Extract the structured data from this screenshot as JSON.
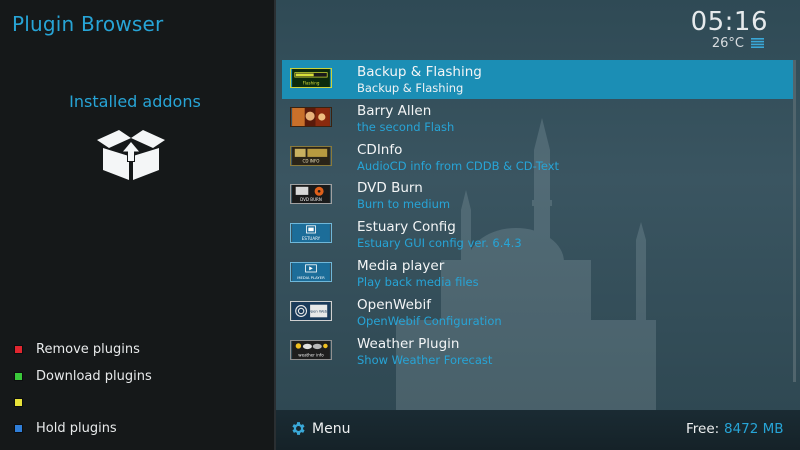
{
  "app": {
    "title": "Plugin Browser"
  },
  "left": {
    "section_title": "Installed addons",
    "box_icon": "open-box-icon",
    "color_keys": [
      {
        "color": "#e0262f",
        "label": "Remove plugins"
      },
      {
        "color": "#3ac83a",
        "label": "Download plugins"
      },
      {
        "color": "#e8e23a",
        "label": ""
      },
      {
        "color": "#2f7ed8",
        "label": "Hold plugins"
      }
    ]
  },
  "status": {
    "time": "05:16",
    "temperature": "26°C",
    "weather_icon": "weather-lines-icon"
  },
  "plugins": [
    {
      "name": "Backup & Flashing",
      "description": "Backup & Flashing",
      "thumb_icon": "flashing-icon",
      "selected": true
    },
    {
      "name": "Barry Allen",
      "description": "the second Flash",
      "thumb_icon": "barry-allen-icon",
      "selected": false
    },
    {
      "name": "CDInfo",
      "description": "AudioCD info from CDDB & CD-Text",
      "thumb_icon": "cdinfo-icon",
      "selected": false
    },
    {
      "name": "DVD Burn",
      "description": "Burn to medium",
      "thumb_icon": "dvd-burn-icon",
      "selected": false
    },
    {
      "name": "Estuary Config",
      "description": "Estuary GUI config ver. 6.4.3",
      "thumb_icon": "estuary-icon",
      "selected": false
    },
    {
      "name": "Media player",
      "description": "Play back media files",
      "thumb_icon": "media-player-icon",
      "selected": false
    },
    {
      "name": "OpenWebif",
      "description": "OpenWebif Configuration",
      "thumb_icon": "openwebif-icon",
      "selected": false
    },
    {
      "name": "Weather Plugin",
      "description": "Show Weather Forecast",
      "thumb_icon": "weather-info-icon",
      "selected": false
    }
  ],
  "thumb_labels": {
    "flashing": "Flashing",
    "cdinfo": "CD INFO",
    "dvd_burn": "DVD BURN",
    "estuary": "ESTUARY",
    "media_player": "MEDIA PLAYER",
    "openwebif": "Open Webif",
    "weather_info": "weather info"
  },
  "bottom": {
    "menu_label": "Menu",
    "free_label": "Free:",
    "free_value": "8472 MB"
  },
  "colors": {
    "accent": "#27a4d6",
    "selected_row": "#1b8eb5"
  }
}
